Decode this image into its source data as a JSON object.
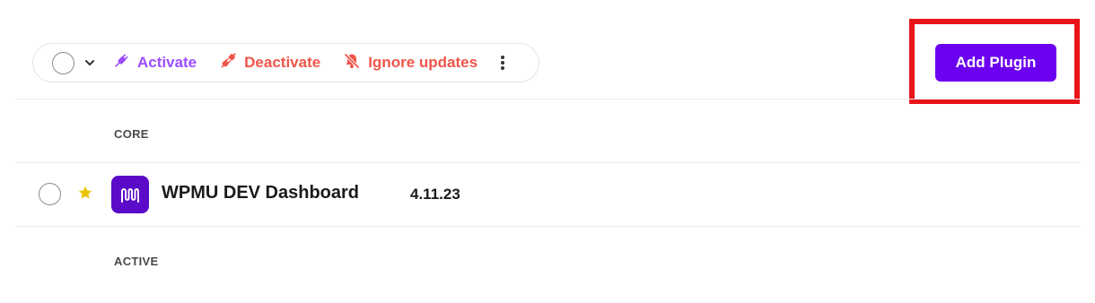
{
  "toolbar": {
    "activate_label": "Activate",
    "deactivate_label": "Deactivate",
    "ignore_updates_label": "Ignore updates",
    "activate_color": "#9b4dff",
    "deactivate_color": "#f0554a"
  },
  "header": {
    "add_plugin_label": "Add Plugin",
    "button_color": "#6c00f0",
    "highlight_color": "#e8141a"
  },
  "sections": {
    "core_label": "CORE",
    "active_label": "ACTIVE"
  },
  "plugins": [
    {
      "name": "WPMU DEV Dashboard",
      "version": "4.11.23",
      "starred": true,
      "logo_color": "#5b0bc8"
    }
  ],
  "icons": {
    "caret": "chevron-down-icon",
    "activate": "plug-connect-icon",
    "deactivate": "plug-disconnect-icon",
    "ignore": "bell-off-icon",
    "more": "kebab-menu-icon",
    "star": "star-icon"
  }
}
